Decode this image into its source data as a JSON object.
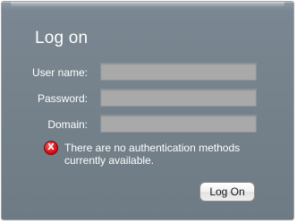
{
  "dialog": {
    "title": "Log on"
  },
  "form": {
    "fields": [
      {
        "label": "User name:",
        "value": ""
      },
      {
        "label": "Password:",
        "value": ""
      },
      {
        "label": "Domain:",
        "value": ""
      }
    ]
  },
  "error": {
    "icon": "error-x-icon",
    "icon_glyph": "X",
    "color": "#d8141c",
    "message": "There are no authentication methods currently available."
  },
  "actions": {
    "logon_label": "Log On"
  },
  "colors": {
    "panel_background": "#738089",
    "field_background": "#a9a9a9"
  }
}
